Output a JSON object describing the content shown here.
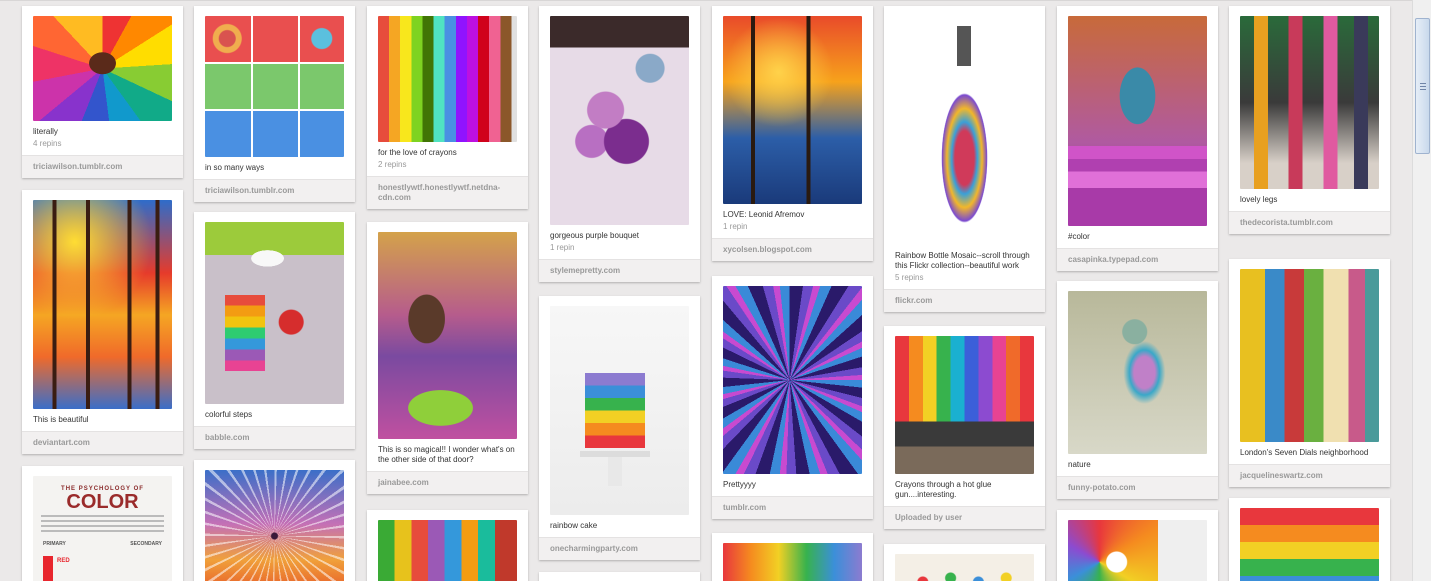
{
  "columns": [
    [
      {
        "desc": "literally",
        "stats": "4 repins",
        "source": "triciawilson.tumblr.com"
      },
      {
        "desc": "This is beautiful",
        "stats": "",
        "source": "deviantart.com"
      },
      {
        "desc": "",
        "stats": "",
        "source": "",
        "poster_kicker": "THE PSYCHOLOGY OF",
        "poster_title": "COLOR",
        "poster_primary": "PRIMARY",
        "poster_secondary": "SECONDARY",
        "poster_red": "RED"
      }
    ],
    [
      {
        "desc": "in so many ways",
        "stats": "",
        "source": "triciawilson.tumblr.com"
      },
      {
        "desc": "colorful steps",
        "stats": "",
        "source": "babble.com"
      },
      {
        "desc": "",
        "stats": "",
        "source": ""
      }
    ],
    [
      {
        "desc": "for the love of crayons",
        "stats": "2 repins",
        "source": "honestlywtf.honestlywtf.netdna-cdn.com"
      },
      {
        "desc": "This is so magical!! I wonder what's on the other side of that door?",
        "stats": "",
        "source": "jainabee.com"
      },
      {
        "desc": "",
        "stats": "",
        "source": ""
      }
    ],
    [
      {
        "desc": "gorgeous purple bouquet",
        "stats": "1 repin",
        "source": "stylemepretty.com"
      },
      {
        "desc": "rainbow cake",
        "stats": "",
        "source": "onecharmingparty.com"
      },
      {
        "desc": "",
        "stats": "",
        "source": ""
      }
    ],
    [
      {
        "desc": "LOVE: Leonid Afremov",
        "stats": "1 repin",
        "source": "xycolsen.blogspot.com"
      },
      {
        "desc": "Prettyyyy",
        "stats": "",
        "source": "tumblr.com"
      },
      {
        "desc": "",
        "stats": "",
        "source": ""
      }
    ],
    [
      {
        "desc": "Rainbow Bottle Mosaic--scroll through this Flickr collection--beautiful work",
        "stats": "5 repins",
        "source": "flickr.com"
      },
      {
        "desc": "Crayons through a hot glue gun....interesting.",
        "stats": "",
        "source": "Uploaded by user"
      },
      {
        "desc": "",
        "stats": "",
        "source": ""
      }
    ],
    [
      {
        "desc": "#color",
        "stats": "",
        "source": "casapinka.typepad.com"
      },
      {
        "desc": "nature",
        "stats": "",
        "source": "funny-potato.com"
      },
      {
        "desc": "",
        "stats": "",
        "source": ""
      }
    ],
    [
      {
        "desc": "lovely legs",
        "stats": "",
        "source": "thedecorista.tumblr.com"
      },
      {
        "desc": "London's Seven Dials neighborhood",
        "stats": "",
        "source": "jacquelineswartz.com"
      },
      {
        "desc": "",
        "stats": "",
        "source": ""
      }
    ]
  ]
}
